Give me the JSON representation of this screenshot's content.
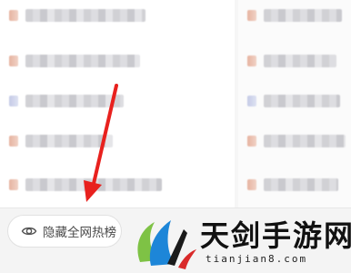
{
  "bottom_bar": {
    "hide_hot_list_label": "隐藏全网热榜",
    "hide_hot_list_icon": "eye-icon"
  },
  "watermark": {
    "brand_text": "天剑手游网",
    "site_url": "tianjian8.com",
    "logo_icon": "tianjian-logo-icon"
  },
  "annotation": {
    "arrow_color": "#e8211e"
  },
  "colors": {
    "button_background": "#ffffff",
    "button_text": "#4a4a4a",
    "bar_background": "#f4f4f4"
  }
}
